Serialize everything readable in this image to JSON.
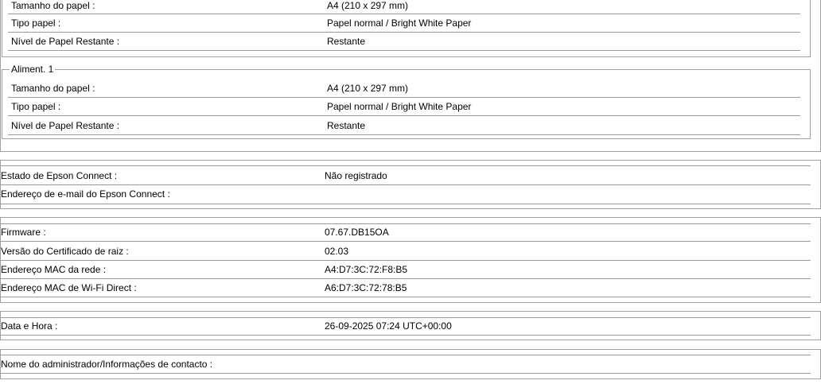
{
  "tray_top": {
    "rows": [
      {
        "label": "Tamanho do papel :",
        "value": "A4 (210 x 297 mm)"
      },
      {
        "label": "Tipo papel :",
        "value": "Papel normal / Bright White Paper"
      },
      {
        "label": "Nível de Papel Restante :",
        "value": "Restante"
      }
    ]
  },
  "tray_1": {
    "legend": "Aliment. 1",
    "rows": [
      {
        "label": "Tamanho do papel :",
        "value": "A4 (210 x 297 mm)"
      },
      {
        "label": "Tipo papel :",
        "value": "Papel normal / Bright White Paper"
      },
      {
        "label": "Nível de Papel Restante :",
        "value": "Restante"
      }
    ]
  },
  "epson_connect": {
    "rows": [
      {
        "label": "Estado de Epson Connect :",
        "value": "Não registrado"
      },
      {
        "label": "Endereço de e-mail do Epson Connect :",
        "value": ""
      }
    ]
  },
  "device_info": {
    "rows": [
      {
        "label": "Firmware :",
        "value": "07.67.DB15OA"
      },
      {
        "label": "Versão do Certificado de raiz :",
        "value": "02.03"
      },
      {
        "label": "Endereço MAC da rede :",
        "value": "A4:D7:3C:72:F8:B5"
      },
      {
        "label": "Endereço MAC de Wi-Fi Direct :",
        "value": "A6:D7:3C:72:78:B5"
      }
    ]
  },
  "datetime": {
    "rows": [
      {
        "label": "Data e Hora :",
        "value": "26-09-2025 07:24 UTC+00:00"
      }
    ]
  },
  "admin": {
    "rows": [
      {
        "label": "Nome do administrador/Informações de contacto :",
        "value": ""
      }
    ]
  }
}
